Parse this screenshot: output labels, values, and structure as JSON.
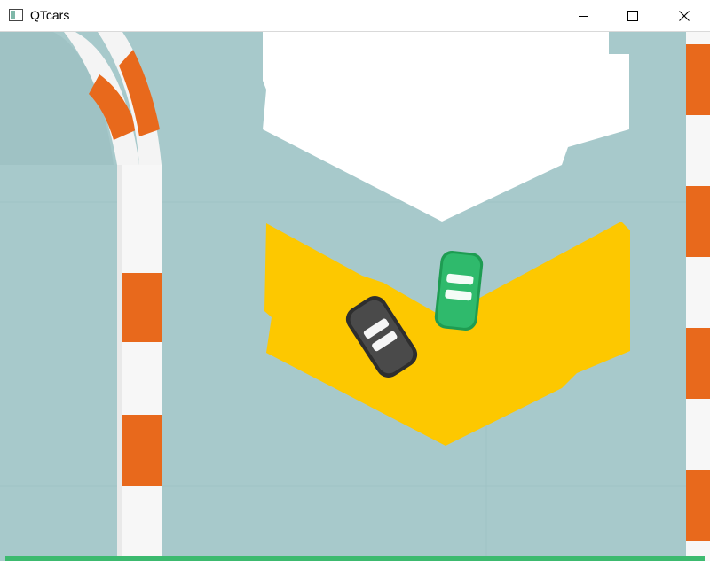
{
  "window": {
    "title": "QTcars",
    "controls": [
      "minimize",
      "maximize",
      "close"
    ]
  },
  "icons": {
    "app": "app-window-icon",
    "minimize": "minimize-icon",
    "maximize": "maximize-icon",
    "close": "close-icon"
  },
  "scene": {
    "colors": {
      "ground": "#a7c9cb",
      "curb_orange": "#e8691c",
      "curb_white": "#f7f7f7",
      "arrow_yellow": "#fdc800",
      "marking_white": "#ffffff",
      "car_green": "#2fba6c",
      "car_dark": "#4a4a4a",
      "bottom_bar": "#3cba6f"
    },
    "cars": [
      {
        "name": "green-car",
        "color": "green"
      },
      {
        "name": "dark-car",
        "color": "dark gray"
      }
    ]
  }
}
